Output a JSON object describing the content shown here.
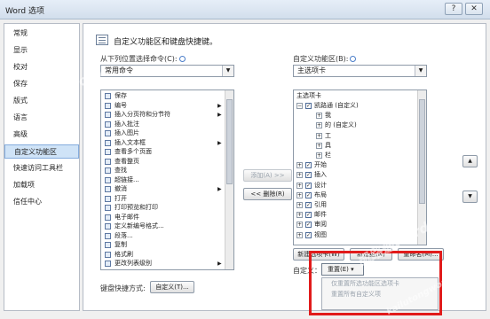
{
  "window": {
    "title": "Word 选项",
    "help_btn": "?",
    "close_btn": "✕"
  },
  "nav": {
    "items": [
      {
        "label": "常规"
      },
      {
        "label": "显示"
      },
      {
        "label": "校对"
      },
      {
        "label": "保存"
      },
      {
        "label": "版式"
      },
      {
        "label": "语言"
      },
      {
        "label": "高级"
      },
      {
        "label": "自定义功能区",
        "active": true
      },
      {
        "label": "快速访问工具栏"
      },
      {
        "label": "加载项"
      },
      {
        "label": "信任中心"
      }
    ]
  },
  "main": {
    "heading": "自定义功能区和键盘快捷键。",
    "left_label": "从下列位置选择命令(C):",
    "left_combo": "常用命令",
    "right_label": "自定义功能区(B):",
    "right_combo": "主选项卡",
    "commands": [
      {
        "label": "保存",
        "arrow": false
      },
      {
        "label": "编号",
        "arrow": true
      },
      {
        "label": "插入分页符和分节符",
        "arrow": true
      },
      {
        "label": "插入批注",
        "arrow": false
      },
      {
        "label": "插入图片",
        "arrow": false
      },
      {
        "label": "插入文本框",
        "arrow": true
      },
      {
        "label": "查看多个页面",
        "arrow": false
      },
      {
        "label": "查看整页",
        "arrow": false
      },
      {
        "label": "查找",
        "arrow": false
      },
      {
        "label": "超链接...",
        "arrow": false
      },
      {
        "label": "撤消",
        "arrow": true
      },
      {
        "label": "打开",
        "arrow": false
      },
      {
        "label": "打印预览和打印",
        "arrow": false
      },
      {
        "label": "电子邮件",
        "arrow": false
      },
      {
        "label": "定义新编号格式...",
        "arrow": false
      },
      {
        "label": "段落...",
        "arrow": false
      },
      {
        "label": "复制",
        "arrow": false
      },
      {
        "label": "格式刷",
        "arrow": false
      },
      {
        "label": "更改列表级别",
        "arrow": true
      }
    ],
    "add_button": "添加(A) >>",
    "remove_button": "<< 删除(R)",
    "tree_header": "主选项卡",
    "tree": [
      {
        "label": "凯路通 (自定义)",
        "indent": 0,
        "expander": "⊟",
        "checked": true
      },
      {
        "label": "我",
        "indent": 1,
        "expander": "⊞",
        "checked": null
      },
      {
        "label": "的 (自定义)",
        "indent": 1,
        "expander": "⊞",
        "checked": null
      },
      {
        "label": "工",
        "indent": 1,
        "expander": "⊞",
        "checked": null
      },
      {
        "label": "具",
        "indent": 1,
        "expander": "⊞",
        "checked": null
      },
      {
        "label": "栏",
        "indent": 1,
        "expander": "⊞",
        "checked": null
      },
      {
        "label": "开始",
        "indent": 0,
        "expander": "⊞",
        "checked": true
      },
      {
        "label": "插入",
        "indent": 0,
        "expander": "⊞",
        "checked": true
      },
      {
        "label": "设计",
        "indent": 0,
        "expander": "⊞",
        "checked": true
      },
      {
        "label": "布局",
        "indent": 0,
        "expander": "⊞",
        "checked": true
      },
      {
        "label": "引用",
        "indent": 0,
        "expander": "⊞",
        "checked": true
      },
      {
        "label": "邮件",
        "indent": 0,
        "expander": "⊞",
        "checked": true
      },
      {
        "label": "审阅",
        "indent": 0,
        "expander": "⊞",
        "checked": true
      },
      {
        "label": "视图",
        "indent": 0,
        "expander": "⊞",
        "checked": true
      }
    ],
    "up_arrow": "▲",
    "down_arrow": "▼",
    "new_tab_button": "新建选项卡(W)",
    "new_group_button": "新建组(N)",
    "rename_button": "重命名(M)...",
    "customize_label": "自定义：",
    "reset_combo": "重置(E) ▾",
    "reset_menu": [
      "仅重置所选功能区选项卡",
      "重置所有自定义项"
    ],
    "keyboard_label": "键盘快捷方式:",
    "keyboard_button": "自定义(T)..."
  },
  "watermark": {
    "text": "凯路通Word",
    "text2": "kailutongword.com"
  },
  "colors": {
    "highlight": "#e11b1b",
    "nav_active": "#cfe3f7"
  }
}
